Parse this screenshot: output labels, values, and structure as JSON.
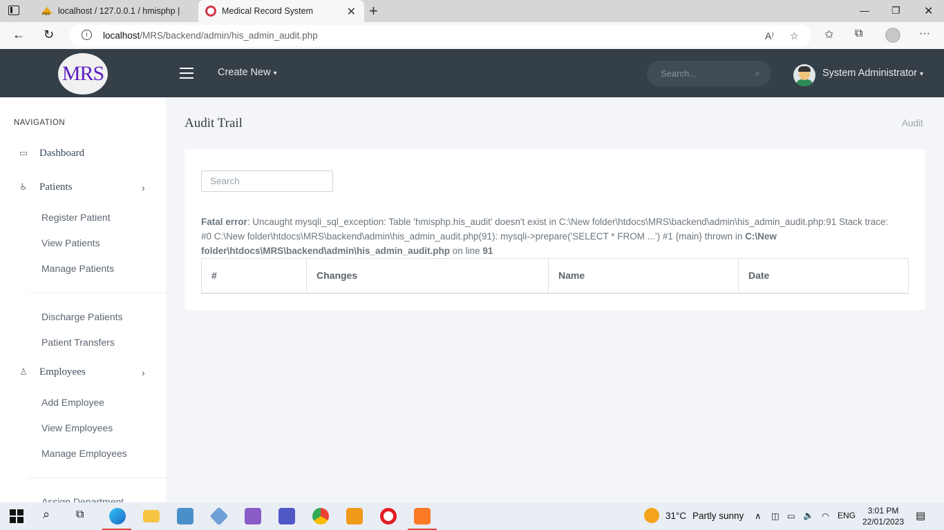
{
  "browser": {
    "tabs": [
      {
        "title": "localhost / 127.0.0.1 / hmisphp | "
      },
      {
        "title": "Medical Record System"
      }
    ],
    "pma_favicon_text": "PMA",
    "url_host": "localhost",
    "url_path": "/MRS/backend/admin/his_admin_audit.php"
  },
  "header": {
    "logo_text": "MRS",
    "create_new": "Create New",
    "search_placeholder": "Search...",
    "user_name": "System Administrator"
  },
  "sidebar": {
    "nav_title": "NAVIGATION",
    "dashboard": "Dashboard",
    "patients": "Patients",
    "patient_subitems": [
      "Register Patient",
      "View Patients",
      "Manage Patients",
      "Discharge Patients",
      "Patient Transfers"
    ],
    "employees": "Employees",
    "employee_subitems": [
      "Add Employee",
      "View Employees",
      "Manage Employees",
      "Assign Department"
    ]
  },
  "main": {
    "page_title": "Audit Trail",
    "breadcrumb": "Audit",
    "search_placeholder": "Search",
    "error": {
      "label": "Fatal error",
      "message": ": Uncaught mysqli_sql_exception: Table 'hmisphp.his_audit' doesn't exist in C:\\New folder\\htdocs\\MRS\\backend\\admin\\his_admin_audit.php:91 Stack trace: #0 C:\\New folder\\htdocs\\MRS\\backend\\admin\\his_admin_audit.php(91): mysqli->prepare('SELECT * FROM ...') #1 {main} thrown in ",
      "file": "C:\\New folder\\htdocs\\MRS\\backend\\admin\\his_admin_audit.php",
      "line_text": " on line ",
      "line": "91"
    },
    "table_headers": [
      "#",
      "Changes",
      "Name",
      "Date"
    ]
  },
  "taskbar": {
    "weather_temp": "31°C",
    "weather_text": "Partly sunny",
    "language": "ENG",
    "time": "3:01 PM",
    "date": "22/01/2023"
  }
}
